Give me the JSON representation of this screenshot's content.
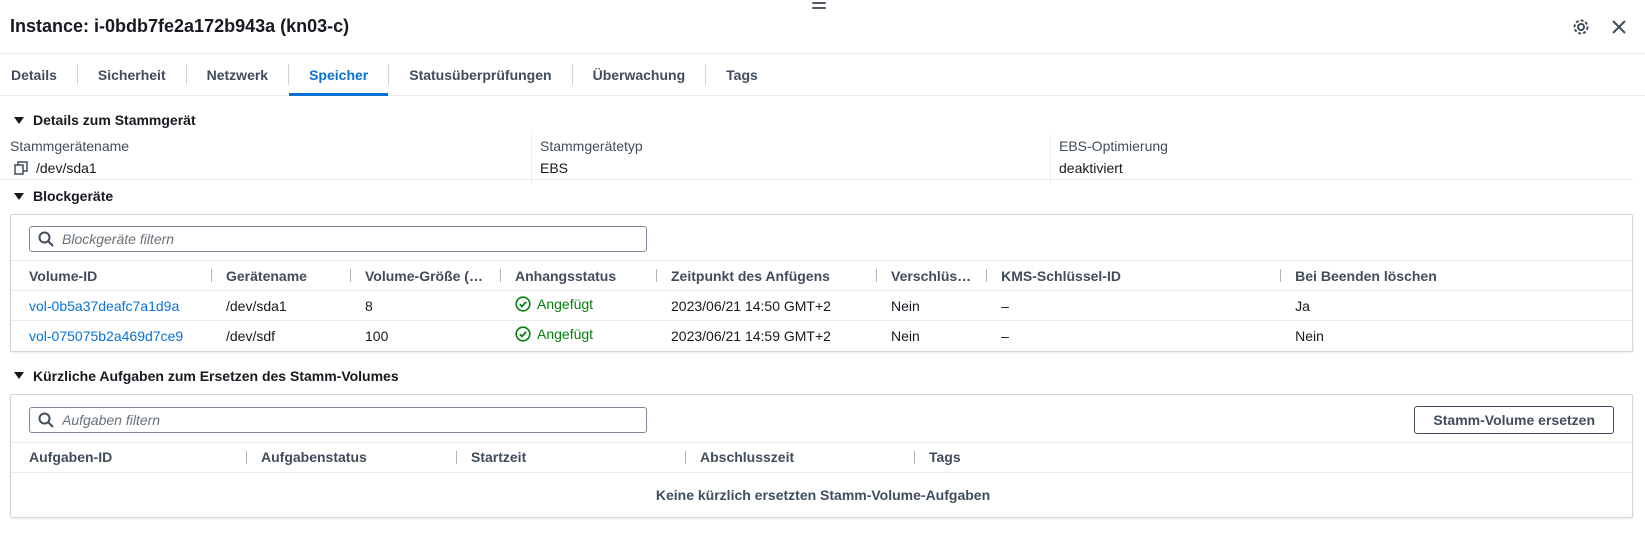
{
  "header": {
    "title": "Instance: i-0bdb7fe2a172b943a (kn03-c)",
    "settings_icon": "gear-icon",
    "close_icon": "close-icon"
  },
  "tabs": [
    {
      "label": "Details",
      "active": false
    },
    {
      "label": "Sicherheit",
      "active": false
    },
    {
      "label": "Netzwerk",
      "active": false
    },
    {
      "label": "Speicher",
      "active": true
    },
    {
      "label": "Statusüberprüfungen",
      "active": false
    },
    {
      "label": "Überwachung",
      "active": false
    },
    {
      "label": "Tags",
      "active": false
    }
  ],
  "root_device": {
    "section_title": "Details zum Stammgerät",
    "name_label": "Stammgerätename",
    "name_value": "/dev/sda1",
    "type_label": "Stammgerätetyp",
    "type_value": "EBS",
    "ebs_label": "EBS-Optimierung",
    "ebs_value": "deaktiviert"
  },
  "block_devices": {
    "section_title": "Blockgeräte",
    "filter_placeholder": "Blockgeräte filtern",
    "columns": [
      "Volume-ID",
      "Gerätename",
      "Volume-Größe (…",
      "Anhangsstatus",
      "Zeitpunkt des Anfügens",
      "Verschlüs…",
      "KMS-Schlüssel-ID",
      "Bei Beenden löschen"
    ],
    "rows": [
      {
        "volume_id": "vol-0b5a37deafc7a1d9a",
        "device": "/dev/sda1",
        "size": "8",
        "status": "Angefügt",
        "attach_time": "2023/06/21 14:50 GMT+2",
        "encrypted": "Nein",
        "kms": "–",
        "delete_on_term": "Ja"
      },
      {
        "volume_id": "vol-075075b2a469d7ce9",
        "device": "/dev/sdf",
        "size": "100",
        "status": "Angefügt",
        "attach_time": "2023/06/21 14:59 GMT+2",
        "encrypted": "Nein",
        "kms": "–",
        "delete_on_term": "Nein"
      }
    ]
  },
  "replace_tasks": {
    "section_title": "Kürzliche Aufgaben zum Ersetzen des Stamm-Volumes",
    "filter_placeholder": "Aufgaben filtern",
    "replace_button": "Stamm-Volume ersetzen",
    "columns": [
      "Aufgaben-ID",
      "Aufgabenstatus",
      "Startzeit",
      "Abschlusszeit",
      "Tags"
    ],
    "empty_text": "Keine kürzlich ersetzten Stamm-Volume-Aufgaben"
  },
  "colors": {
    "link": "#0972d3",
    "success": "#037f0c",
    "text": "#16191f"
  }
}
